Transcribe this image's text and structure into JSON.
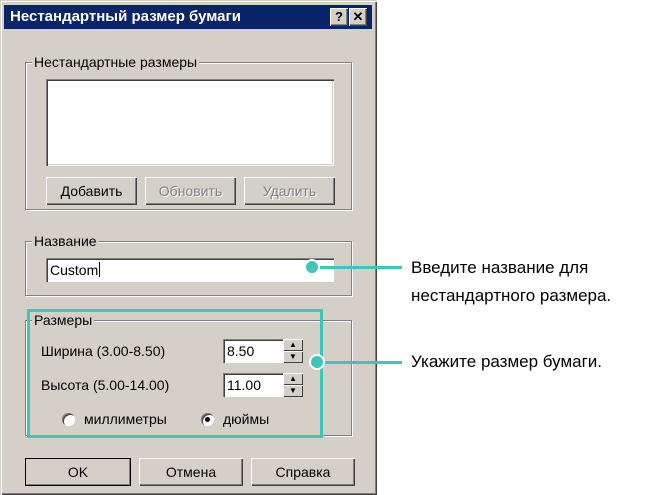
{
  "dialog": {
    "title": "Нестандартный размер бумаги",
    "help_button": "?",
    "close_button": "✕"
  },
  "custom_sizes": {
    "legend": "Нестандартные размеры",
    "items": [],
    "add_button": "Добавить",
    "update_button": "Обновить",
    "delete_button": "Удалить"
  },
  "name_group": {
    "legend": "Название",
    "value": "Custom"
  },
  "dimensions": {
    "legend": "Размеры",
    "width_label": "Ширина (3.00-8.50)",
    "width_value": "8.50",
    "height_label": "Высота (5.00-14.00)",
    "height_value": "11.00",
    "unit_mm": "миллиметры",
    "unit_inch": "дюймы",
    "selected_unit": "дюймы"
  },
  "footer": {
    "ok_button": "OK",
    "cancel_button": "Отмена",
    "help_button": "Справка"
  },
  "annotations": {
    "name_line1": "Введите название для",
    "name_line2": "нестандартного размера.",
    "size_line": "Укажите размер бумаги.",
    "color": "#3ec6b9"
  }
}
